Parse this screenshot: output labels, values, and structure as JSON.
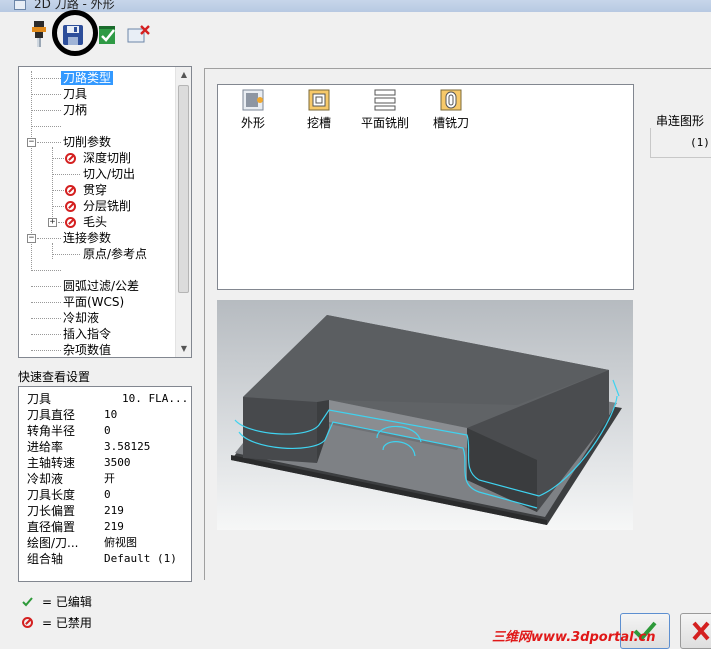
{
  "window": {
    "title": "2D 刀路 - 外形"
  },
  "toolbar": {
    "buttons": [
      {
        "name": "tool-icon"
      },
      {
        "name": "save-icon"
      },
      {
        "name": "apply-icon"
      },
      {
        "name": "delete-icon"
      }
    ]
  },
  "tree": {
    "items": [
      {
        "label": "刀路类型",
        "selected": true
      },
      {
        "label": "刀具"
      },
      {
        "label": "刀柄"
      },
      {
        "label": ""
      },
      {
        "label": "切削参数"
      },
      {
        "label": "深度切削",
        "disabled": true
      },
      {
        "label": "切入/切出"
      },
      {
        "label": "贯穿",
        "disabled": true
      },
      {
        "label": "分层铣削",
        "disabled": true
      },
      {
        "label": "毛头",
        "disabled": true
      },
      {
        "label": "连接参数"
      },
      {
        "label": "原点/参考点"
      },
      {
        "label": ""
      },
      {
        "label": "圆弧过滤/公差"
      },
      {
        "label": "平面(WCS)"
      },
      {
        "label": "冷却液"
      },
      {
        "label": "插入指令"
      },
      {
        "label": "杂项数值"
      }
    ]
  },
  "quick_view": {
    "title": "快速查看设置",
    "rows": [
      {
        "key": "刀具",
        "value": "10. FLA..."
      },
      {
        "key": "刀具直径",
        "value": "10"
      },
      {
        "key": "转角半径",
        "value": "0"
      },
      {
        "key": "进给率",
        "value": "3.58125"
      },
      {
        "key": "主轴转速",
        "value": "3500"
      },
      {
        "key": "冷却液",
        "value": "开"
      },
      {
        "key": "刀具长度",
        "value": "0"
      },
      {
        "key": "刀长偏置",
        "value": "219"
      },
      {
        "key": "直径偏置",
        "value": "219"
      },
      {
        "key": "绘图/刀...",
        "value": "俯视图"
      },
      {
        "key": "组合轴",
        "value": "Default (1)"
      }
    ]
  },
  "legend": {
    "edited": "= 已编辑",
    "disabled": "= 已禁用"
  },
  "toolpath_types": [
    {
      "label": "外形",
      "icon": "contour-icon"
    },
    {
      "label": "挖槽",
      "icon": "pocket-icon"
    },
    {
      "label": "平面铣削",
      "icon": "facing-icon"
    },
    {
      "label": "槽铣刀",
      "icon": "slot-mill-icon"
    }
  ],
  "chain": {
    "label": "串连图形",
    "count": "(1)"
  },
  "watermark": "三维网www.3dportal.cn",
  "colors": {
    "selection": "#3399ff",
    "disabled_red": "#d42020",
    "toolpath_cyan": "#3fd3f0",
    "part_gray": "#585a5c"
  }
}
